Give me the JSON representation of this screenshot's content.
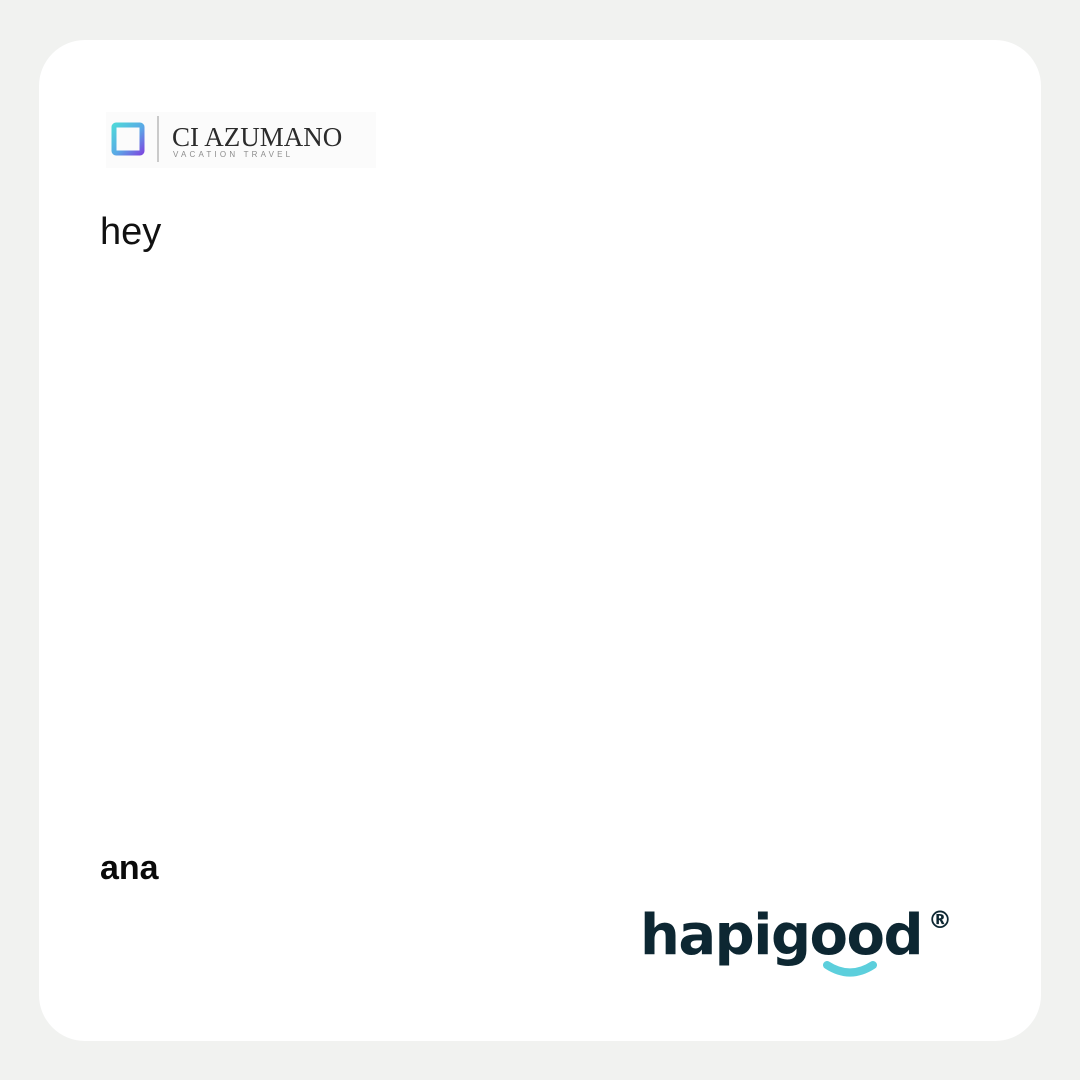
{
  "brand": {
    "name": "CI AZUMANO",
    "tagline": "VACATION TRAVEL",
    "icon": "square-frame-icon"
  },
  "message": {
    "text": "hey"
  },
  "sender": {
    "name": "ana"
  },
  "footer_brand": {
    "name": "hapigood",
    "registered_mark": "®",
    "icon": "smile-icon"
  },
  "colors": {
    "background": "#f1f2f0",
    "card": "#ffffff",
    "hapigood_text": "#0d2732",
    "hapigood_smile": "#5ccfdc",
    "logo_gradient_start": "#4fd6d9",
    "logo_gradient_end": "#7a4ee0"
  }
}
